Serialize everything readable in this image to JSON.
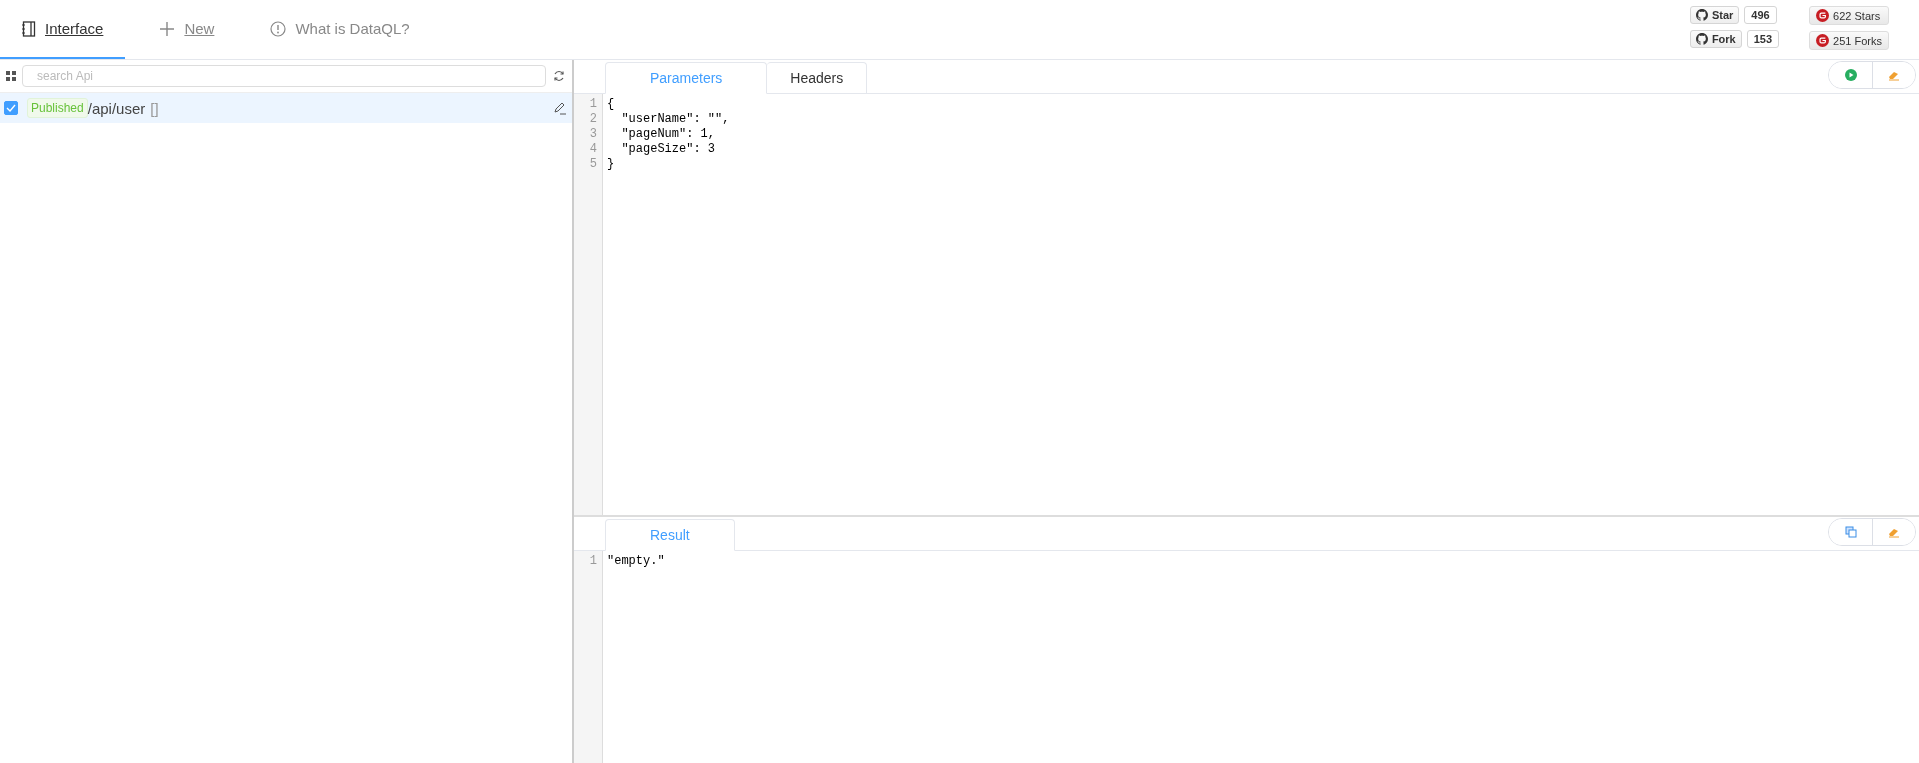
{
  "nav_tabs": [
    {
      "kind": "book",
      "label": "Interface",
      "selected": true
    },
    {
      "kind": "plus",
      "label": "New",
      "selected": false
    },
    {
      "kind": "info",
      "label": "What is DataQL?",
      "selected": false
    }
  ],
  "github": [
    {
      "label": "Star",
      "count": "496"
    },
    {
      "label": "Fork",
      "count": "153"
    }
  ],
  "gitee": [
    "622 Stars",
    "251 Forks"
  ],
  "sidebar": {
    "search": {
      "placeholder": "search Api"
    },
    "items": [
      {
        "checked": true,
        "selected": true,
        "status": "Published",
        "path": "/api/user",
        "suffix": "[]"
      }
    ]
  },
  "request": {
    "tabs": [
      {
        "label": "Parameters",
        "selected": true
      },
      {
        "label": "Headers",
        "selected": false
      }
    ],
    "lines": [
      {
        "number": "1",
        "code": "{"
      },
      {
        "number": "2",
        "code": "  \"userName\": \"\","
      },
      {
        "number": "3",
        "code": "  \"pageNum\": 1,"
      },
      {
        "number": "4",
        "code": "  \"pageSize\": 3"
      },
      {
        "number": "5",
        "code": "}"
      }
    ]
  },
  "result": {
    "tabs": [
      {
        "label": "Result",
        "selected": true
      }
    ],
    "lines": [
      {
        "number": "1",
        "code": "\"empty.\""
      }
    ]
  }
}
